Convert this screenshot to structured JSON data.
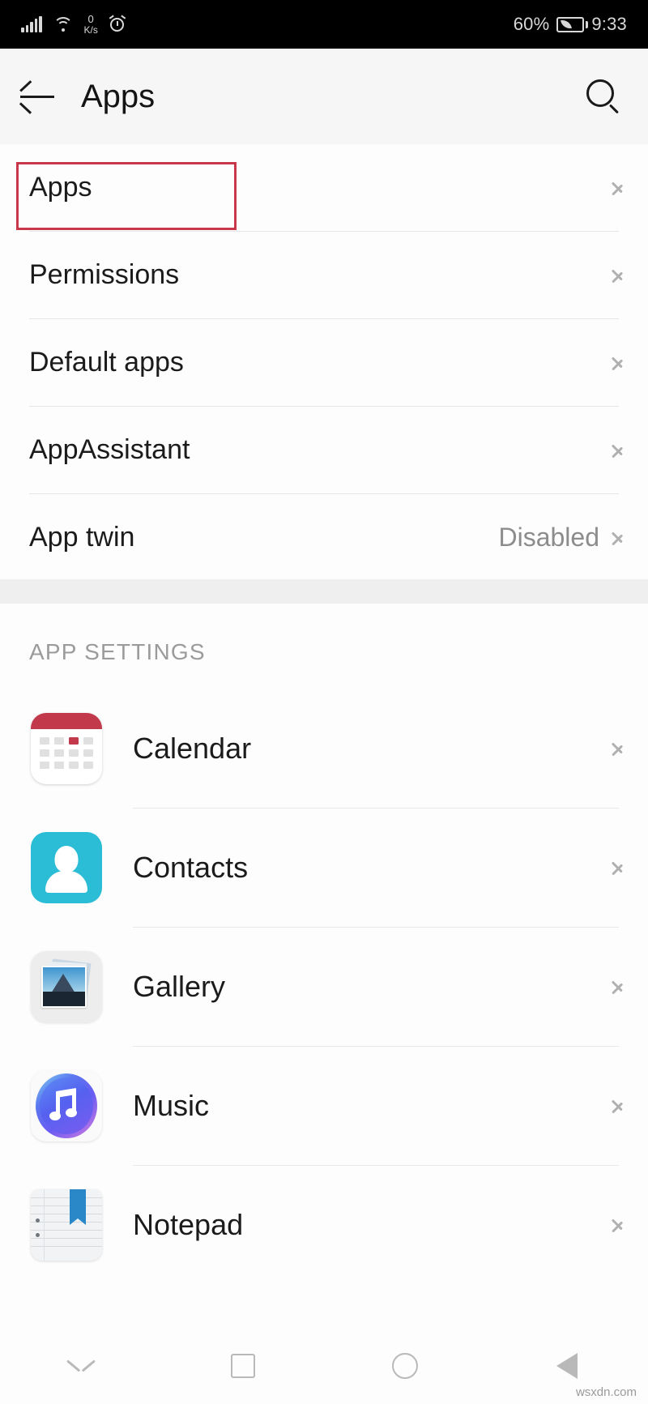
{
  "statusbar": {
    "network_speed_value": "0",
    "network_speed_unit": "K/s",
    "battery_percent": "60%",
    "clock": "9:33",
    "icons": [
      "signal-bars-icon",
      "wifi-icon",
      "network-speed-icon",
      "alarm-clock-icon",
      "battery-saver-icon"
    ]
  },
  "appbar": {
    "back_label": "back-arrow-icon",
    "title": "Apps",
    "search_label": "search-icon"
  },
  "settings_group": {
    "rows": [
      {
        "label": "Apps",
        "value": "",
        "highlighted": true
      },
      {
        "label": "Permissions",
        "value": "",
        "highlighted": false
      },
      {
        "label": "Default apps",
        "value": "",
        "highlighted": false
      },
      {
        "label": "AppAssistant",
        "value": "",
        "highlighted": false
      },
      {
        "label": "App twin",
        "value": "Disabled",
        "highlighted": false
      }
    ]
  },
  "app_settings": {
    "section_title": "APP SETTINGS",
    "apps": [
      {
        "name": "Calendar",
        "icon": "calendar-app-icon"
      },
      {
        "name": "Contacts",
        "icon": "contacts-app-icon"
      },
      {
        "name": "Gallery",
        "icon": "gallery-app-icon"
      },
      {
        "name": "Music",
        "icon": "music-app-icon"
      },
      {
        "name": "Notepad",
        "icon": "notepad-app-icon"
      }
    ]
  },
  "navbar": {
    "items": [
      {
        "name": "hide-navbar-chevron-icon"
      },
      {
        "name": "recents-square-icon"
      },
      {
        "name": "home-circle-icon"
      },
      {
        "name": "back-triangle-icon"
      }
    ]
  },
  "watermark": "wsxdn.com",
  "colors": {
    "annotation": "#c9384a",
    "appbar_bg": "#f6f6f6",
    "calendar_red": "#c2394b",
    "contacts_cyan": "#2bbcd6",
    "notepad_blue": "#2a87c8"
  }
}
